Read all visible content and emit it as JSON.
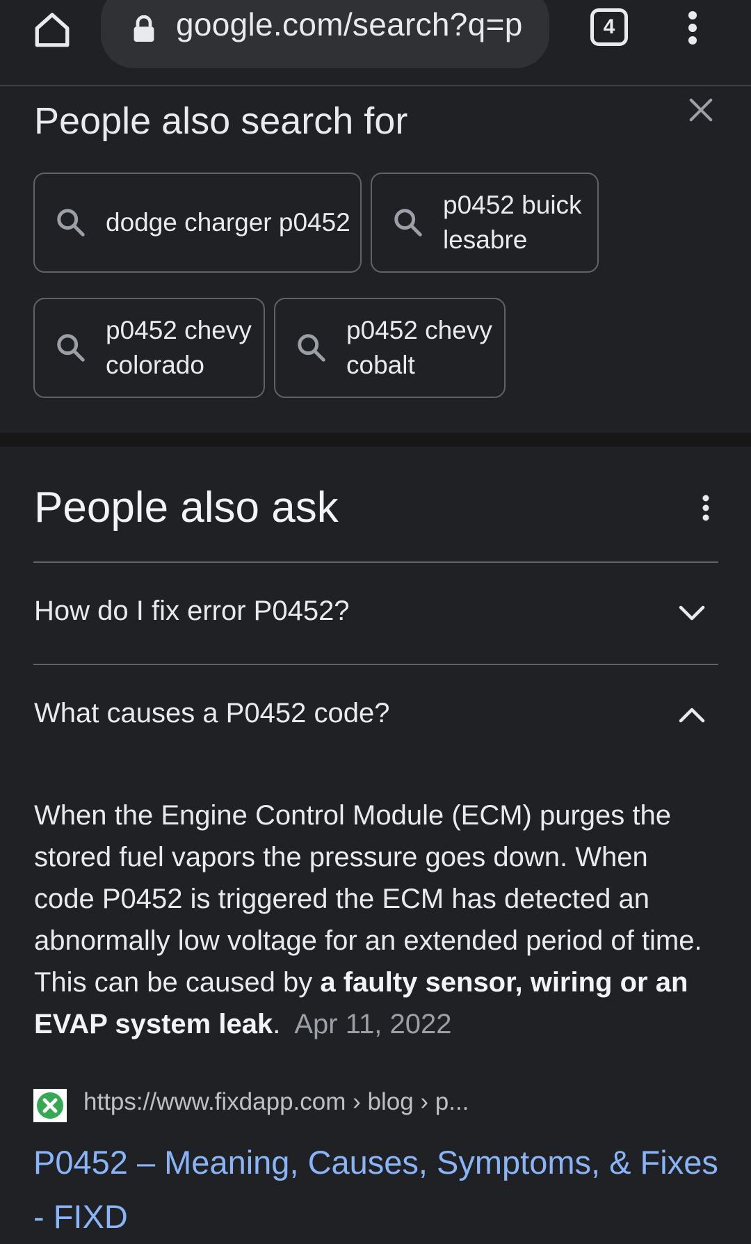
{
  "browser": {
    "url": "google.com/search?q=p",
    "tab_count": "4"
  },
  "people_also_search_for": {
    "title": "People also search for",
    "chips": [
      {
        "line1": "dodge charger p0452",
        "line2": ""
      },
      {
        "line1": "p0452 buick",
        "line2": "lesabre"
      },
      {
        "line1": "p0452 chevy",
        "line2": "colorado"
      },
      {
        "line1": "p0452 chevy",
        "line2": "cobalt"
      }
    ]
  },
  "people_also_ask": {
    "title": "People also ask",
    "questions": [
      {
        "text": "How do I fix error P0452?",
        "expanded": false
      },
      {
        "text": "What causes a P0452 code?",
        "expanded": true
      }
    ],
    "answer": {
      "text": "When the Engine Control Module (ECM) purges the stored fuel vapors the pressure goes down. When code P0452 is triggered the ECM has detected an abnormally low voltage for an extended period of time. This can be caused by ",
      "bold": "a faulty sensor, wiring or an EVAP system leak",
      "after_bold": ".",
      "date": "Apr 11, 2022"
    },
    "source": {
      "cite": "https://www.fixdapp.com › blog › p...",
      "title": "P0452 – Meaning, Causes, Symptoms, & Fixes - FIXD"
    }
  },
  "colors": {
    "background": "#202124",
    "text": "#e8eaed",
    "link": "#8ab4f8",
    "muted": "#9aa0a6",
    "border": "#5f6368",
    "favicon_green": "#34a853"
  },
  "icons": [
    "home-icon",
    "lock-icon",
    "tabs-icon",
    "more-vert-icon",
    "close-icon",
    "search-icon",
    "chevron-down-icon",
    "chevron-up-icon",
    "fixd-favicon"
  ]
}
